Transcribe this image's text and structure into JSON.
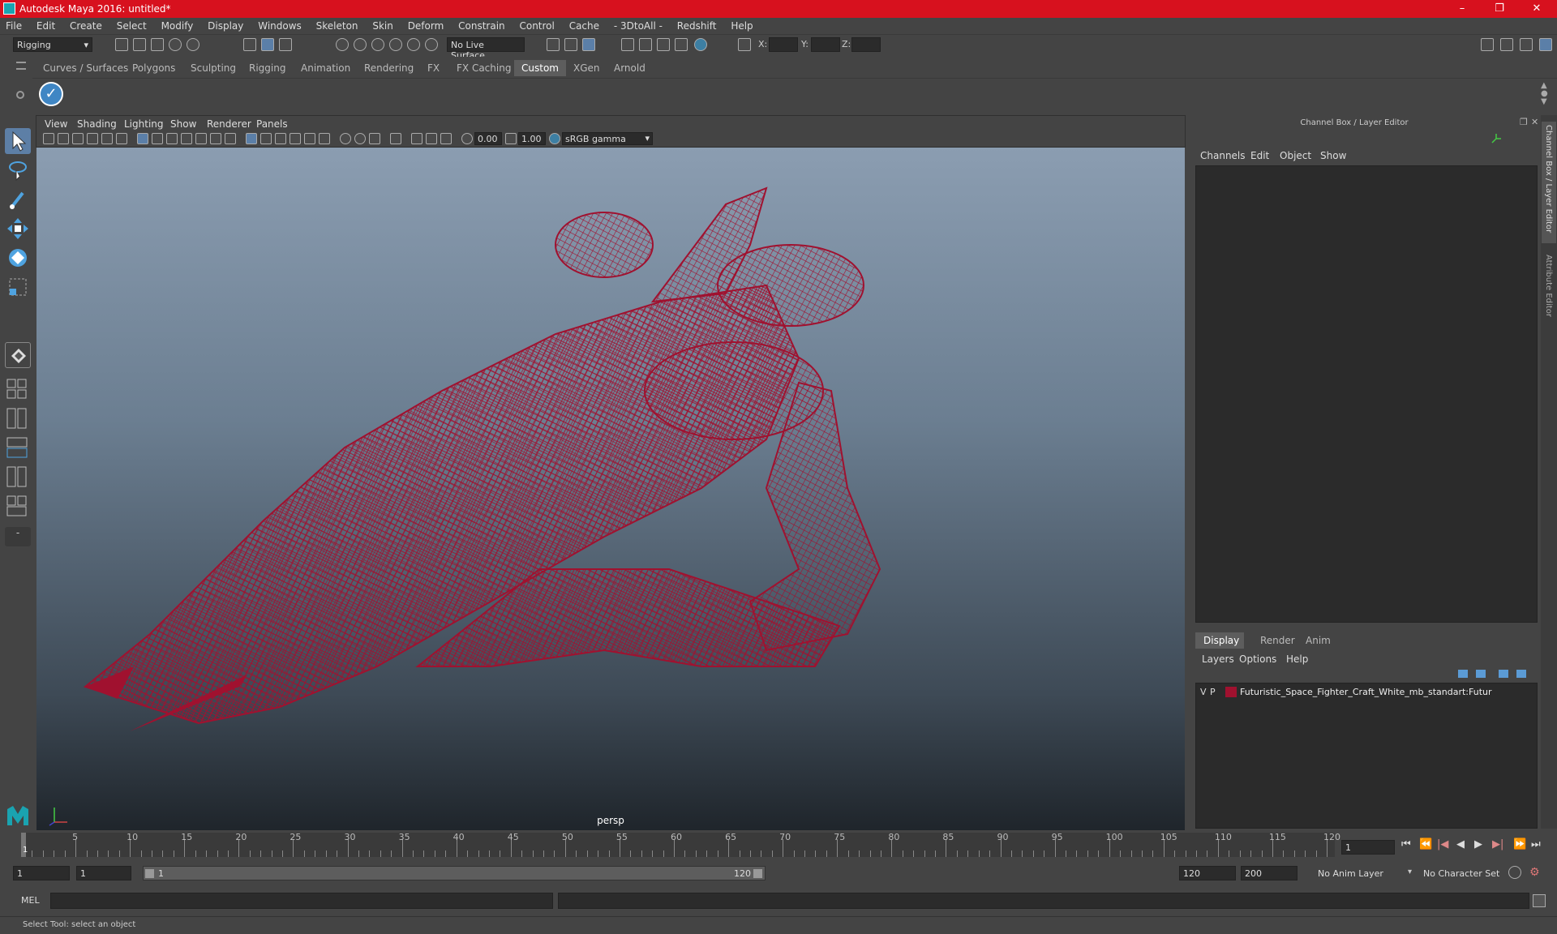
{
  "title": "Autodesk Maya 2016: untitled*",
  "window_buttons": {
    "minimize": "–",
    "maximize": "❐",
    "close": "✕"
  },
  "menus": [
    "File",
    "Edit",
    "Create",
    "Select",
    "Modify",
    "Display",
    "Windows",
    "Skeleton",
    "Skin",
    "Deform",
    "Constrain",
    "Control",
    "Cache",
    "- 3DtoAll -",
    "Redshift",
    "Help"
  ],
  "statusline": {
    "mode": "Rigging",
    "live_surface": "No Live Surface",
    "x_label": "X:",
    "y_label": "Y:",
    "z_label": "Z:"
  },
  "shelf_tabs": [
    "Curves / Surfaces",
    "Polygons",
    "Sculpting",
    "Rigging",
    "Animation",
    "Rendering",
    "FX",
    "FX Caching",
    "Custom",
    "XGen",
    "Arnold"
  ],
  "shelf_active_tab": "Custom",
  "viewport": {
    "menus": [
      "View",
      "Shading",
      "Lighting",
      "Show",
      "Renderer",
      "Panels"
    ],
    "exposure": "0.00",
    "gamma": "1.00",
    "color_space": "sRGB gamma",
    "camera_label": "persp",
    "wire_color": "#a0112f"
  },
  "channel_box": {
    "title": "Channel Box / Layer Editor",
    "menus": [
      "Channels",
      "Edit",
      "Object",
      "Show"
    ],
    "layer_tabs": [
      "Display",
      "Render",
      "Anim"
    ],
    "layer_tab_active": "Display",
    "layer_menus": [
      "Layers",
      "Options",
      "Help"
    ],
    "layer": {
      "v": "V",
      "p": "P",
      "color": "#a0112f",
      "name": "Futuristic_Space_Fighter_Craft_White_mb_standart:Futur"
    }
  },
  "side_tabs": {
    "channel": "Channel Box / Layer Editor",
    "attribute": "Attribute Editor"
  },
  "timeline": {
    "ticks": [
      "5",
      "10",
      "15",
      "20",
      "25",
      "30",
      "35",
      "40",
      "45",
      "50",
      "55",
      "60",
      "65",
      "70",
      "75",
      "80",
      "85",
      "90",
      "95",
      "100",
      "105",
      "110",
      "115",
      "120"
    ],
    "start_marker": "1",
    "current_frame": "1"
  },
  "range": {
    "start": "1",
    "playback_start": "1",
    "slider_start": "1",
    "slider_end": "120",
    "playback_end": "120",
    "end": "200",
    "anim_layer": "No Anim Layer",
    "character_set": "No Character Set"
  },
  "mel": {
    "label": "MEL"
  },
  "help_line": "Select Tool: select an object"
}
